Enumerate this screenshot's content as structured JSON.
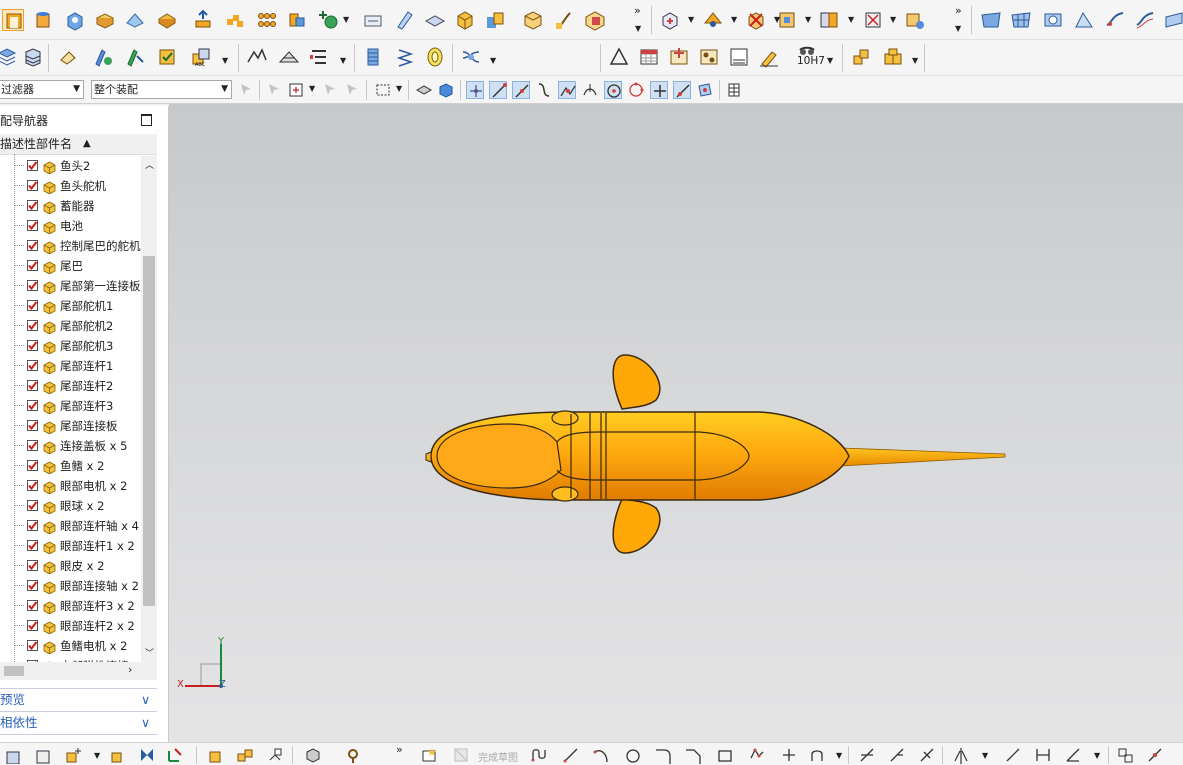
{
  "toolbar": {
    "filter_select": "过滤器",
    "assembly_select": "整个装配",
    "fit_label": "10H7",
    "more_glyph": "»",
    "finish_sketch_label": "完成草图"
  },
  "navigator": {
    "title": "配导航器",
    "column_header": "描述性部件名",
    "sort_glyph": "▲",
    "items": [
      {
        "label": "鱼头2"
      },
      {
        "label": "鱼头舵机"
      },
      {
        "label": "蓄能器"
      },
      {
        "label": "电池"
      },
      {
        "label": "控制尾巴的舵机"
      },
      {
        "label": "尾巴"
      },
      {
        "label": "尾部第一连接板"
      },
      {
        "label": "尾部舵机1"
      },
      {
        "label": "尾部舵机2"
      },
      {
        "label": "尾部舵机3"
      },
      {
        "label": "尾部连杆1"
      },
      {
        "label": "尾部连杆2"
      },
      {
        "label": "尾部连杆3"
      },
      {
        "label": "尾部连接板"
      },
      {
        "label": "连接盖板 x 5"
      },
      {
        "label": "鱼鳍 x 2"
      },
      {
        "label": "眼部电机 x 2"
      },
      {
        "label": "眼球 x 2"
      },
      {
        "label": "眼部连杆轴 x 4"
      },
      {
        "label": "眼部连杆1 x 2"
      },
      {
        "label": "眼皮 x 2"
      },
      {
        "label": "眼部连接轴 x 2"
      },
      {
        "label": "眼部连杆3 x 2"
      },
      {
        "label": "眼部连杆2 x 2"
      },
      {
        "label": "鱼鳍电机 x 2"
      },
      {
        "label": "中部弹性连接"
      }
    ],
    "panels": [
      {
        "label": "预览"
      },
      {
        "label": "相依性"
      }
    ]
  },
  "viewport": {
    "axis_x": "X",
    "axis_y": "Y",
    "axis_z": "Z",
    "model_color": "#ffa808"
  },
  "colors": {
    "check_red": "#d01818",
    "cube_yellow": "#f2c43a",
    "panel_blue": "#2a62b8"
  }
}
